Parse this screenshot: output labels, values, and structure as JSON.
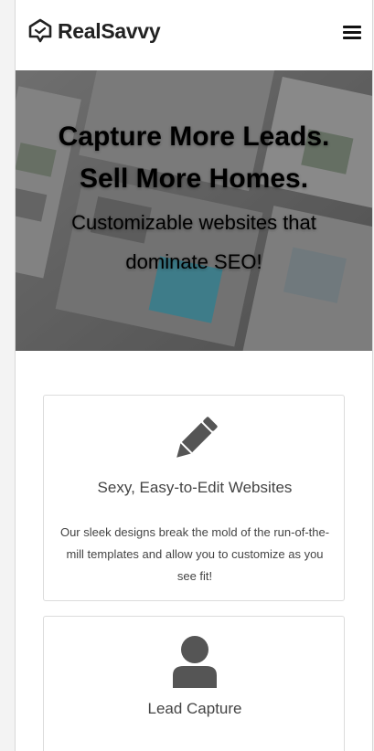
{
  "header": {
    "brand": "RealSavvy",
    "logo_icon": "house-chat-logo-icon",
    "menu_icon": "hamburger-menu-icon"
  },
  "hero": {
    "headline_line1": "Capture More Leads.",
    "headline_line2": "Sell More Homes.",
    "subheadline": "Customizable websites that dominate SEO!"
  },
  "features": [
    {
      "icon": "pencil-icon",
      "title": "Sexy, Easy-to-Edit Websites",
      "text": "Our sleek designs break the mold of the run-of-the-mill templates and allow you to customize as you see fit!"
    },
    {
      "icon": "user-icon",
      "title": "Lead Capture",
      "text": ""
    }
  ],
  "colors": {
    "icon": "#555555",
    "text": "#444444",
    "border": "#dcdcdc"
  }
}
